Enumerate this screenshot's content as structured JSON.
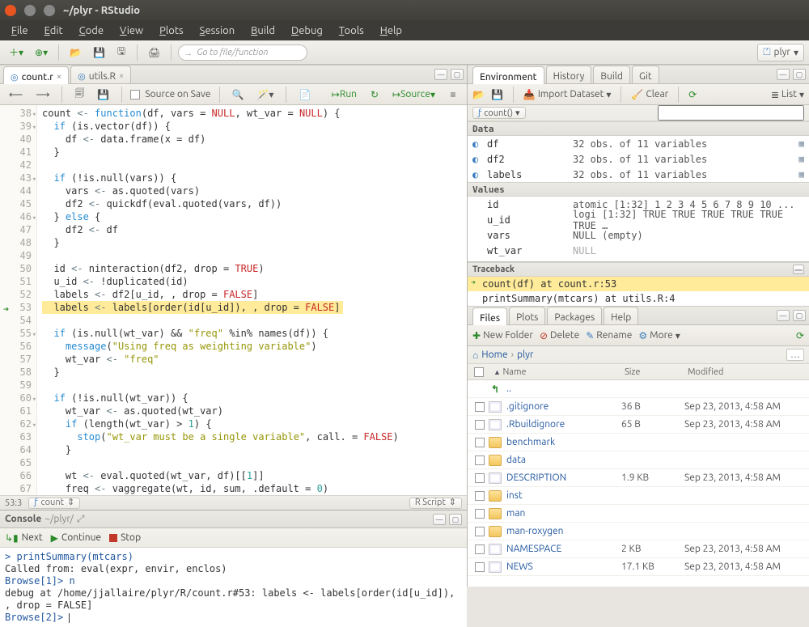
{
  "window": {
    "title": "~/plyr - RStudio"
  },
  "menubar": {
    "items": [
      "File",
      "Edit",
      "Code",
      "View",
      "Plots",
      "Session",
      "Build",
      "Debug",
      "Tools",
      "Help"
    ]
  },
  "toolbar": {
    "go_to_placeholder": "Go to file/function",
    "project_label": "plyr"
  },
  "source": {
    "tabs": [
      {
        "label": "count.r",
        "active": true
      },
      {
        "label": "utils.R",
        "active": false
      }
    ],
    "source_on_save": "Source on Save",
    "run_label": "Run",
    "source_label": "Source",
    "status_pos": "53:3",
    "status_scope": "count",
    "status_lang": "R Script",
    "lines": [
      {
        "n": 38,
        "fold": "▾",
        "raw": "count <- function(df, vars = NULL, wt_var = NULL) {"
      },
      {
        "n": 39,
        "fold": "▾",
        "raw": "  if (is.vector(df)) {"
      },
      {
        "n": 40,
        "raw": "    df <- data.frame(x = df)"
      },
      {
        "n": 41,
        "raw": "  }"
      },
      {
        "n": 42,
        "raw": ""
      },
      {
        "n": 43,
        "fold": "▾",
        "raw": "  if (!is.null(vars)) {"
      },
      {
        "n": 44,
        "raw": "    vars <- as.quoted(vars)"
      },
      {
        "n": 45,
        "raw": "    df2 <- quickdf(eval.quoted(vars, df))"
      },
      {
        "n": 46,
        "fold": "▾",
        "raw": "  } else {"
      },
      {
        "n": 47,
        "raw": "    df2 <- df"
      },
      {
        "n": 48,
        "raw": "  }"
      },
      {
        "n": 49,
        "raw": ""
      },
      {
        "n": 50,
        "raw": "  id <- ninteraction(df2, drop = TRUE)"
      },
      {
        "n": 51,
        "raw": "  u_id <- !duplicated(id)"
      },
      {
        "n": 52,
        "raw": "  labels <- df2[u_id, , drop = FALSE]"
      },
      {
        "n": 53,
        "bp": true,
        "hl": true,
        "raw": "  labels <- labels[order(id[u_id]), , drop = FALSE]"
      },
      {
        "n": 54,
        "raw": ""
      },
      {
        "n": 55,
        "fold": "▾",
        "raw": "  if (is.null(wt_var) && \"freq\" %in% names(df)) {"
      },
      {
        "n": 56,
        "raw": "    message(\"Using freq as weighting variable\")"
      },
      {
        "n": 57,
        "raw": "    wt_var <- \"freq\""
      },
      {
        "n": 58,
        "raw": "  }"
      },
      {
        "n": 59,
        "raw": ""
      },
      {
        "n": 60,
        "fold": "▾",
        "raw": "  if (!is.null(wt_var)) {"
      },
      {
        "n": 61,
        "raw": "    wt_var <- as.quoted(wt_var)"
      },
      {
        "n": 62,
        "fold": "▾",
        "raw": "    if (length(wt_var) > 1) {"
      },
      {
        "n": 63,
        "raw": "      stop(\"wt_var must be a single variable\", call. = FALSE)"
      },
      {
        "n": 64,
        "raw": "    }"
      },
      {
        "n": 65,
        "raw": ""
      },
      {
        "n": 66,
        "raw": "    wt <- eval.quoted(wt_var, df)[[1]]"
      },
      {
        "n": 67,
        "raw": "    freq <- vaggregate(wt, id, sum, .default = 0)"
      }
    ]
  },
  "console": {
    "title": "Console",
    "path": "~/plyr/",
    "debug": {
      "next": "Next",
      "continue": "Continue",
      "stop": "Stop"
    },
    "lines": [
      {
        "type": "cmd",
        "text": "> printSummary(mtcars)"
      },
      {
        "type": "out",
        "text": "Called from: eval(expr, envir, enclos)"
      },
      {
        "type": "cmd",
        "text": "Browse[1]> n"
      },
      {
        "type": "out",
        "text": "debug at /home/jjallaire/plyr/R/count.r#53: labels <- labels[order(id[u_id]), , drop = FALSE]"
      },
      {
        "type": "prompt",
        "text": "Browse[2]> "
      }
    ]
  },
  "env": {
    "tabs": [
      "Environment",
      "History",
      "Build",
      "Git"
    ],
    "import_label": "Import Dataset",
    "clear_label": "Clear",
    "view_label": "List",
    "scope": "count()",
    "sections": [
      {
        "title": "Data",
        "rows": [
          {
            "icon": "◐",
            "name": "df",
            "desc": "32 obs. of 11 variables",
            "grid": true
          },
          {
            "icon": "◐",
            "name": "df2",
            "desc": "32 obs. of 11 variables",
            "grid": true
          },
          {
            "icon": "◐",
            "name": "labels",
            "desc": "32 obs. of 11 variables",
            "grid": true
          }
        ]
      },
      {
        "title": "Values",
        "rows": [
          {
            "name": "id",
            "desc": "atomic [1:32] 1 2 3 4 5 6 7 8 9 10 ..."
          },
          {
            "name": "u_id",
            "desc": "logi [1:32] TRUE TRUE TRUE TRUE TRUE TRUE …"
          },
          {
            "name": "vars",
            "desc": "NULL (empty)"
          },
          {
            "name": "wt_var",
            "desc": "NULL",
            "dim": true
          }
        ]
      }
    ],
    "traceback": {
      "title": "Traceback",
      "frames": [
        {
          "text": "count(df) at count.r:53",
          "current": true
        },
        {
          "text": "printSummary(mtcars) at utils.R:4"
        }
      ]
    }
  },
  "files": {
    "tabs": [
      "Files",
      "Plots",
      "Packages",
      "Help"
    ],
    "toolbar": {
      "new_folder": "New Folder",
      "delete": "Delete",
      "rename": "Rename",
      "more": "More"
    },
    "breadcrumb": [
      "Home",
      "plyr"
    ],
    "columns": {
      "name": "Name",
      "size": "Size",
      "modified": "Modified"
    },
    "rows": [
      {
        "up": true,
        "name": ".."
      },
      {
        "type": "file",
        "name": ".gitignore",
        "size": "36 B",
        "mod": "Sep 23, 2013, 4:58 AM"
      },
      {
        "type": "file",
        "name": ".Rbuildignore",
        "size": "65 B",
        "mod": "Sep 23, 2013, 4:58 AM"
      },
      {
        "type": "folder",
        "name": "benchmark"
      },
      {
        "type": "folder",
        "name": "data"
      },
      {
        "type": "file",
        "name": "DESCRIPTION",
        "size": "1.9 KB",
        "mod": "Sep 23, 2013, 4:58 AM"
      },
      {
        "type": "folder",
        "name": "inst"
      },
      {
        "type": "folder",
        "name": "man"
      },
      {
        "type": "folder",
        "name": "man-roxygen"
      },
      {
        "type": "file",
        "name": "NAMESPACE",
        "size": "2 KB",
        "mod": "Sep 23, 2013, 4:58 AM"
      },
      {
        "type": "file",
        "name": "NEWS",
        "size": "17.1 KB",
        "mod": "Sep 23, 2013, 4:58 AM"
      }
    ]
  }
}
